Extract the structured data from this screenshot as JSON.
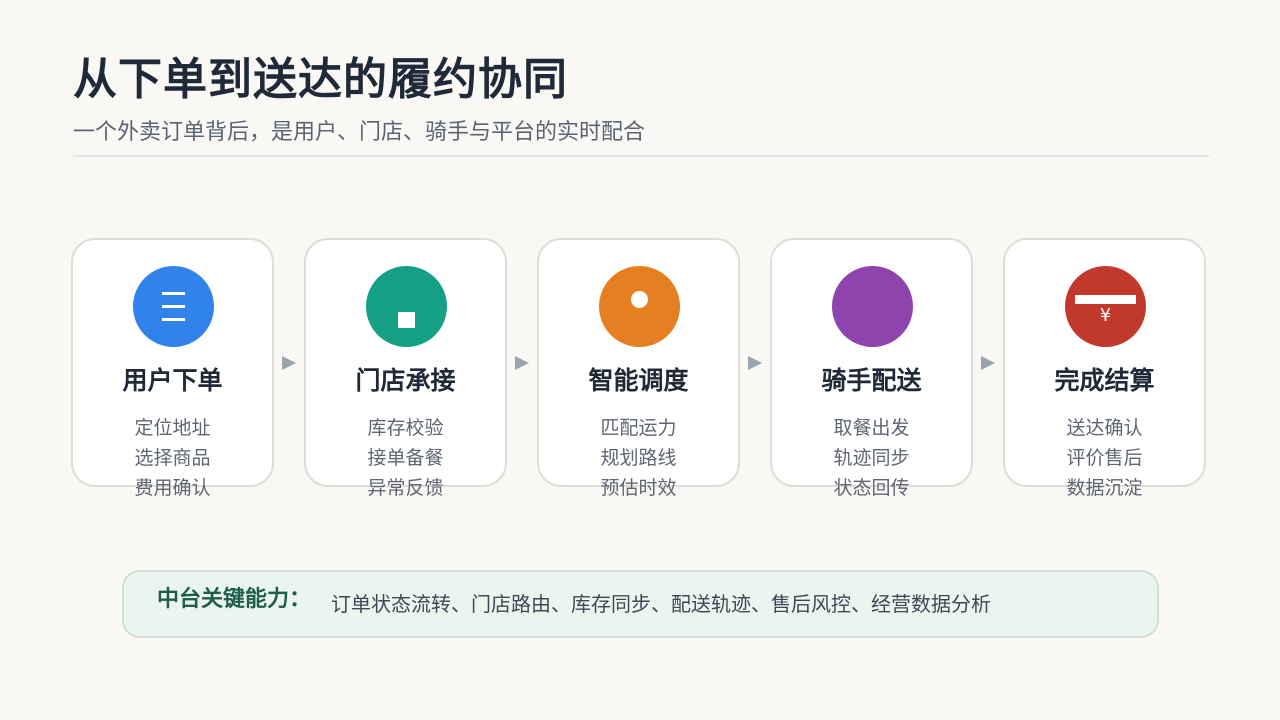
{
  "title": "从下单到送达的履约协同",
  "subtitle": "一个外卖订单背后，是用户、门店、骑手与平台的实时配合",
  "colors": {
    "blue": "#3282ec",
    "green": "#15a085",
    "orange": "#e67f22",
    "purple": "#8e44ad",
    "red": "#c0392b",
    "arrow": "#9aa3ae"
  },
  "steps": [
    {
      "title": "用户下单",
      "icon": "menu-lines-icon",
      "color": "#3282ec",
      "items": [
        "定位地址",
        "选择商品",
        "费用确认"
      ]
    },
    {
      "title": "门店承接",
      "icon": "store-square-icon",
      "color": "#15a085",
      "items": [
        "库存校验",
        "接单备餐",
        "异常反馈"
      ]
    },
    {
      "title": "智能调度",
      "icon": "location-dot-icon",
      "color": "#e67f22",
      "items": [
        "匹配运力",
        "规划路线",
        "预估时效"
      ]
    },
    {
      "title": "骑手配送",
      "icon": "rider-icon",
      "color": "#8e44ad",
      "items": [
        "取餐出发",
        "轨迹同步",
        "状态回传"
      ]
    },
    {
      "title": "完成结算",
      "icon": "yen-payment-icon",
      "color": "#c0392b",
      "yen": "¥",
      "items": [
        "送达确认",
        "评价售后",
        "数据沉淀"
      ]
    }
  ],
  "callout": {
    "label": "中台关键能力：",
    "text": "订单状态流转、门店路由、库存同步、配送轨迹、售后风控、经营数据分析"
  }
}
